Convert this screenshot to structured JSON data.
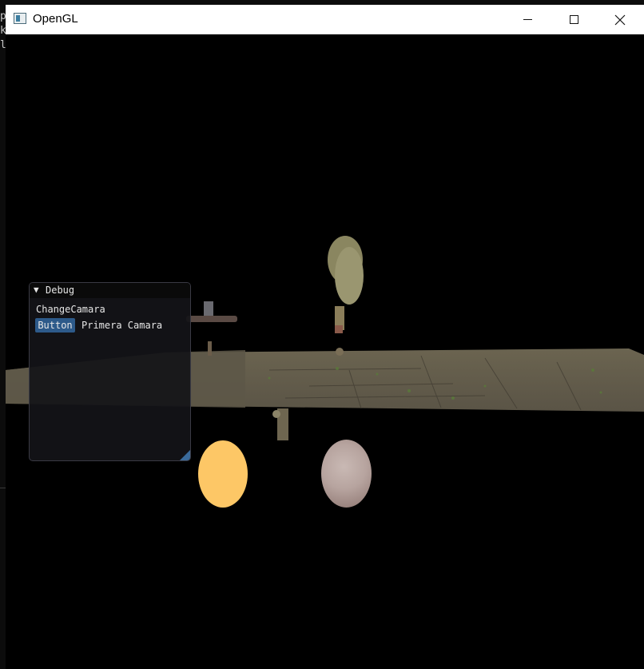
{
  "background_console": {
    "glyphs": [
      "p",
      "k",
      "l"
    ]
  },
  "window": {
    "title": "OpenGL",
    "controls": {
      "minimize_icon": "minimize-icon",
      "maximize_icon": "maximize-icon",
      "close_icon": "close-icon"
    }
  },
  "debug_window": {
    "title": "Debug",
    "collapse_icon": "triangle-down-icon",
    "label": "ChangeCamara",
    "button_label": "Button",
    "camera_label": "Primera Camara"
  },
  "colors": {
    "titlebar": "#ffffff",
    "viewport": "#000000",
    "imgui_button": "#2d5a8a",
    "sun_sphere": "#fdc766"
  }
}
